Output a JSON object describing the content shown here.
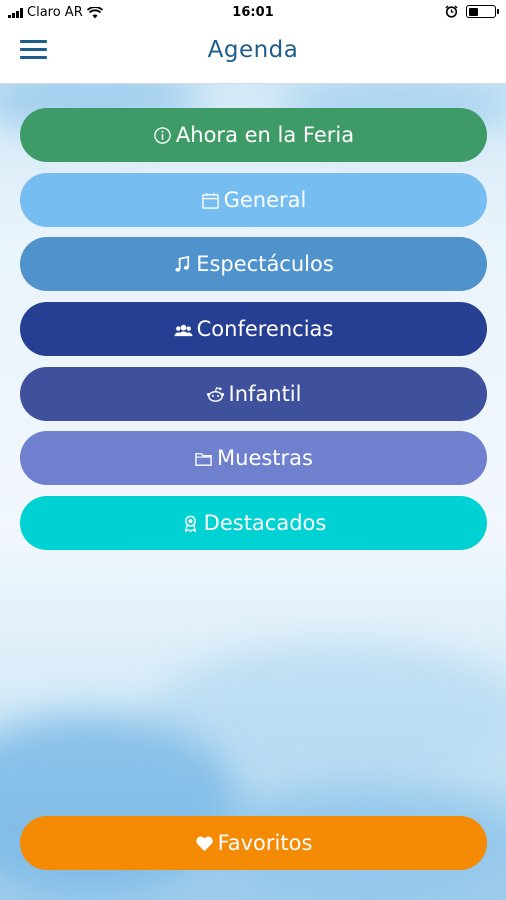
{
  "status_bar": {
    "carrier": "Claro AR",
    "time": "16:01"
  },
  "nav": {
    "title": "Agenda",
    "menu_icon": "hamburger-menu-icon"
  },
  "menu": [
    {
      "label": "Ahora en la Feria",
      "icon": "info-icon",
      "color": "#3e9b67"
    },
    {
      "label": "General",
      "icon": "calendar-icon",
      "color": "#76bdf2"
    },
    {
      "label": "Espectáculos",
      "icon": "music-note-icon",
      "color": "#5092cb"
    },
    {
      "label": "Conferencias",
      "icon": "group-icon",
      "color": "#263f93"
    },
    {
      "label": "Infantil",
      "icon": "reddit-alien-icon",
      "color": "#3f519d"
    },
    {
      "label": "Muestras",
      "icon": "folder-icon",
      "color": "#6e80ce"
    },
    {
      "label": "Destacados",
      "icon": "award-icon",
      "color": "#00d1d3"
    }
  ],
  "favorites": {
    "label": "Favoritos",
    "icon": "heart-icon",
    "color": "#f58a05"
  }
}
